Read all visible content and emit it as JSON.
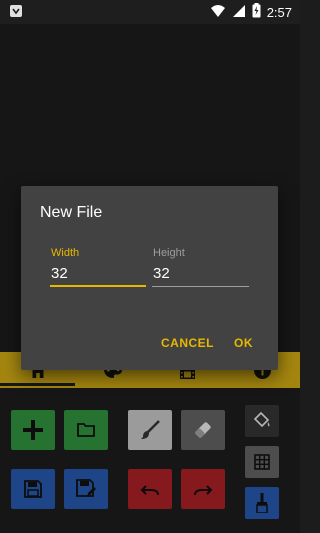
{
  "status_bar": {
    "time": "2:57",
    "battery_icon": "battery-charging-icon",
    "wifi_icon": "wifi-icon",
    "signal_icon": "cell-signal-icon",
    "notif_icon": "android-notification-icon"
  },
  "tabs": [
    {
      "id": "home",
      "icon": "home-icon",
      "selected": true
    },
    {
      "id": "palette",
      "icon": "palette-icon",
      "selected": false
    },
    {
      "id": "film",
      "icon": "film-icon",
      "selected": false
    },
    {
      "id": "info",
      "icon": "info-icon",
      "selected": false
    }
  ],
  "toolbar": {
    "new": "add-icon",
    "open": "folder-icon",
    "brush": "brush-icon",
    "eraser": "eraser-icon",
    "fill": "paint-bucket-icon",
    "save": "save-icon",
    "save_as": "save-as-icon",
    "undo": "undo-icon",
    "redo": "redo-icon",
    "grid": "grid-icon",
    "color": "color-brush-icon"
  },
  "dialog": {
    "title": "New File",
    "width_label": "Width",
    "width_value": "32",
    "height_label": "Height",
    "height_value": "32",
    "cancel_label": "CANCEL",
    "ok_label": "OK"
  },
  "colors": {
    "accent": "#e6b800",
    "tabbar": "#c8a413",
    "dialog_bg": "#424242"
  }
}
